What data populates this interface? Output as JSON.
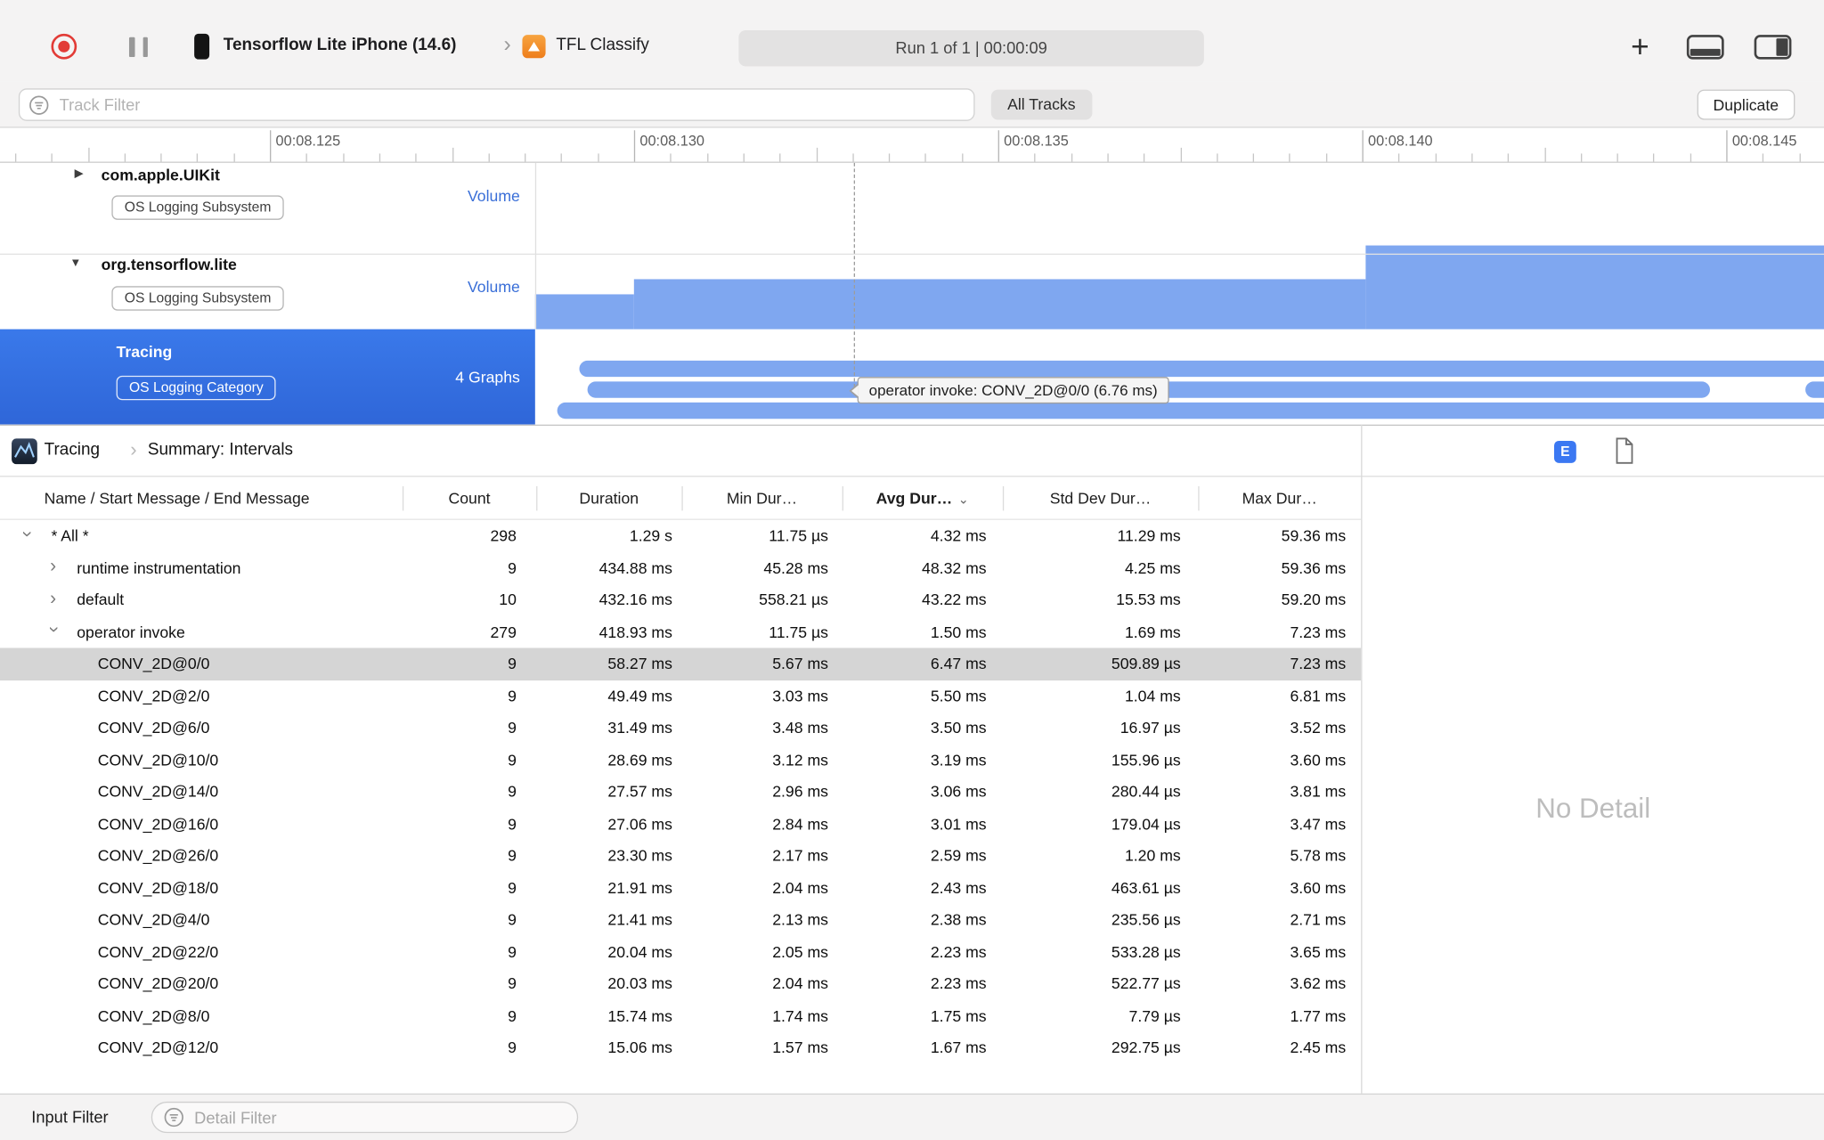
{
  "toolbar": {
    "device": "Tensorflow Lite iPhone (14.6)",
    "target": "TFL Classify",
    "status": "Run 1 of 1  |  00:00:09"
  },
  "filter_bar": {
    "track_filter_placeholder": "Track Filter",
    "all_tracks": "All Tracks",
    "duplicate": "Duplicate"
  },
  "ruler": {
    "labels": [
      "00:08.125",
      "00:08.130",
      "00:08.135",
      "00:08.140",
      "00:08.145"
    ]
  },
  "tracks_area": {
    "tooltip": "operator invoke: CONV_2D@0/0 (6.76 ms)",
    "tracks": [
      {
        "name": "com.apple.UIKit",
        "badge": "OS Logging Subsystem",
        "meta": "Volume",
        "disclosure": "collapsed"
      },
      {
        "name": "org.tensorflow.lite",
        "badge": "OS Logging Subsystem",
        "meta": "Volume",
        "disclosure": "expanded"
      },
      {
        "name": "Tracing",
        "badge": "OS Logging Category",
        "meta": "4 Graphs",
        "selected": true
      }
    ]
  },
  "detail_header": {
    "instrument": "Tracing",
    "summary": "Summary: Intervals",
    "e_button": "E"
  },
  "table": {
    "columns": [
      {
        "label": "Name / Start Message / End Message"
      },
      {
        "label": "Count"
      },
      {
        "label": "Duration"
      },
      {
        "label": "Min Dur…"
      },
      {
        "label": "Avg Dur…",
        "sorted": true
      },
      {
        "label": "Std Dev Dur…"
      },
      {
        "label": "Max Dur…"
      }
    ],
    "rows": [
      {
        "level": 0,
        "disclosure": "expanded",
        "name": "* All *",
        "count": "298",
        "duration": "1.29 s",
        "min": "11.75 µs",
        "avg": "4.32 ms",
        "std": "11.29 ms",
        "max": "59.36 ms"
      },
      {
        "level": 1,
        "disclosure": "collapsed",
        "name": "runtime instrumentation",
        "count": "9",
        "duration": "434.88 ms",
        "min": "45.28 ms",
        "avg": "48.32 ms",
        "std": "4.25 ms",
        "max": "59.36 ms"
      },
      {
        "level": 1,
        "disclosure": "collapsed",
        "name": "default",
        "count": "10",
        "duration": "432.16 ms",
        "min": "558.21 µs",
        "avg": "43.22 ms",
        "std": "15.53 ms",
        "max": "59.20 ms"
      },
      {
        "level": 1,
        "disclosure": "expanded",
        "name": "operator invoke",
        "count": "279",
        "duration": "418.93 ms",
        "min": "11.75 µs",
        "avg": "1.50 ms",
        "std": "1.69 ms",
        "max": "7.23 ms"
      },
      {
        "level": 2,
        "name": "CONV_2D@0/0",
        "count": "9",
        "duration": "58.27 ms",
        "min": "5.67 ms",
        "avg": "6.47 ms",
        "std": "509.89 µs",
        "max": "7.23 ms",
        "selected": true
      },
      {
        "level": 2,
        "name": "CONV_2D@2/0",
        "count": "9",
        "duration": "49.49 ms",
        "min": "3.03 ms",
        "avg": "5.50 ms",
        "std": "1.04 ms",
        "max": "6.81 ms"
      },
      {
        "level": 2,
        "name": "CONV_2D@6/0",
        "count": "9",
        "duration": "31.49 ms",
        "min": "3.48 ms",
        "avg": "3.50 ms",
        "std": "16.97 µs",
        "max": "3.52 ms"
      },
      {
        "level": 2,
        "name": "CONV_2D@10/0",
        "count": "9",
        "duration": "28.69 ms",
        "min": "3.12 ms",
        "avg": "3.19 ms",
        "std": "155.96 µs",
        "max": "3.60 ms"
      },
      {
        "level": 2,
        "name": "CONV_2D@14/0",
        "count": "9",
        "duration": "27.57 ms",
        "min": "2.96 ms",
        "avg": "3.06 ms",
        "std": "280.44 µs",
        "max": "3.81 ms"
      },
      {
        "level": 2,
        "name": "CONV_2D@16/0",
        "count": "9",
        "duration": "27.06 ms",
        "min": "2.84 ms",
        "avg": "3.01 ms",
        "std": "179.04 µs",
        "max": "3.47 ms"
      },
      {
        "level": 2,
        "name": "CONV_2D@26/0",
        "count": "9",
        "duration": "23.30 ms",
        "min": "2.17 ms",
        "avg": "2.59 ms",
        "std": "1.20 ms",
        "max": "5.78 ms"
      },
      {
        "level": 2,
        "name": "CONV_2D@18/0",
        "count": "9",
        "duration": "21.91 ms",
        "min": "2.04 ms",
        "avg": "2.43 ms",
        "std": "463.61 µs",
        "max": "3.60 ms"
      },
      {
        "level": 2,
        "name": "CONV_2D@4/0",
        "count": "9",
        "duration": "21.41 ms",
        "min": "2.13 ms",
        "avg": "2.38 ms",
        "std": "235.56 µs",
        "max": "2.71 ms"
      },
      {
        "level": 2,
        "name": "CONV_2D@22/0",
        "count": "9",
        "duration": "20.04 ms",
        "min": "2.05 ms",
        "avg": "2.23 ms",
        "std": "533.28 µs",
        "max": "3.65 ms"
      },
      {
        "level": 2,
        "name": "CONV_2D@20/0",
        "count": "9",
        "duration": "20.03 ms",
        "min": "2.04 ms",
        "avg": "2.23 ms",
        "std": "522.77 µs",
        "max": "3.62 ms"
      },
      {
        "level": 2,
        "name": "CONV_2D@8/0",
        "count": "9",
        "duration": "15.74 ms",
        "min": "1.74 ms",
        "avg": "1.75 ms",
        "std": "7.79 µs",
        "max": "1.77 ms"
      },
      {
        "level": 2,
        "name": "CONV_2D@12/0",
        "count": "9",
        "duration": "15.06 ms",
        "min": "1.57 ms",
        "avg": "1.67 ms",
        "std": "292.75 µs",
        "max": "2.45 ms"
      }
    ]
  },
  "detail_panel": {
    "empty_text": "No Detail"
  },
  "bottom_bar": {
    "label": "Input Filter",
    "detail_filter_placeholder": "Detail Filter"
  },
  "icons": {
    "record": "red-record-circle",
    "pause": "pause-bars",
    "device": "iphone",
    "app": "orange-app-square",
    "filter": "circle-with-lines",
    "sort": "chevron-down",
    "panel_toggle_1": "bottom-pane",
    "panel_toggle_2": "right-pane",
    "document": "page-outline",
    "instrument": "tracing-instrument"
  }
}
